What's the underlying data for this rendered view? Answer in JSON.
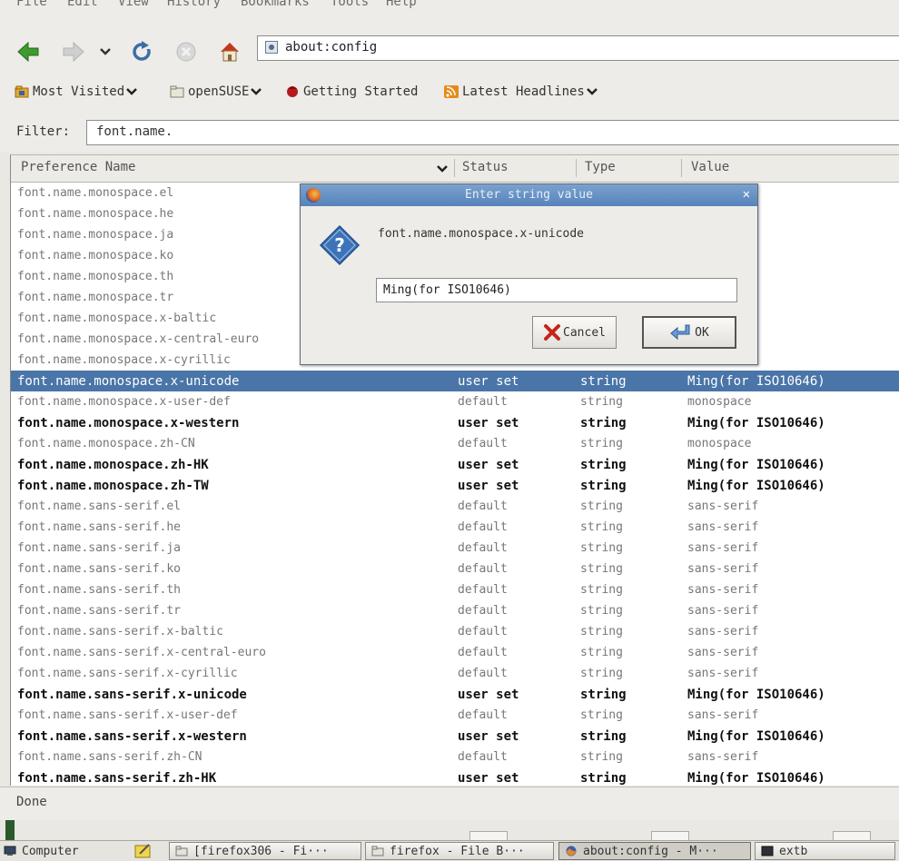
{
  "menubar": {
    "items": [
      "File",
      "Edit",
      "View",
      "History",
      "Bookmarks",
      "Tools",
      "Help"
    ]
  },
  "nav": {
    "url": "about:config"
  },
  "bookmarks": [
    {
      "label": "Most Visited",
      "icon": "most-visited-icon",
      "dropdown": true
    },
    {
      "label": "openSUSE",
      "icon": "folder-icon",
      "dropdown": true
    },
    {
      "label": "Getting Started",
      "icon": "getting-started-icon",
      "dropdown": false
    },
    {
      "label": "Latest Headlines",
      "icon": "rss-feed-icon",
      "dropdown": true
    }
  ],
  "filter": {
    "label": "Filter:",
    "value": "font.name."
  },
  "table": {
    "columns": [
      "Preference Name",
      "Status",
      "Type",
      "Value"
    ],
    "rows": [
      {
        "name": "font.name.monospace.el",
        "status": "",
        "type": "",
        "value": "",
        "state": "default"
      },
      {
        "name": "font.name.monospace.he",
        "status": "",
        "type": "",
        "value": "",
        "state": "default"
      },
      {
        "name": "font.name.monospace.ja",
        "status": "",
        "type": "",
        "value": "",
        "state": "default"
      },
      {
        "name": "font.name.monospace.ko",
        "status": "",
        "type": "",
        "value": "",
        "state": "default"
      },
      {
        "name": "font.name.monospace.th",
        "status": "",
        "type": "",
        "value": "",
        "state": "default"
      },
      {
        "name": "font.name.monospace.tr",
        "status": "",
        "type": "",
        "value": "",
        "state": "default"
      },
      {
        "name": "font.name.monospace.x-baltic",
        "status": "",
        "type": "",
        "value": "",
        "state": "default"
      },
      {
        "name": "font.name.monospace.x-central-euro",
        "status": "",
        "type": "",
        "value": "",
        "state": "default"
      },
      {
        "name": "font.name.monospace.x-cyrillic",
        "status": "",
        "type": "",
        "value": "",
        "state": "default"
      },
      {
        "name": "font.name.monospace.x-unicode",
        "status": "user set",
        "type": "string",
        "value": "Ming(for ISO10646)",
        "state": "selected"
      },
      {
        "name": "font.name.monospace.x-user-def",
        "status": "default",
        "type": "string",
        "value": "monospace",
        "state": "default"
      },
      {
        "name": "font.name.monospace.x-western",
        "status": "user set",
        "type": "string",
        "value": "Ming(for ISO10646)",
        "state": "userset"
      },
      {
        "name": "font.name.monospace.zh-CN",
        "status": "default",
        "type": "string",
        "value": "monospace",
        "state": "default"
      },
      {
        "name": "font.name.monospace.zh-HK",
        "status": "user set",
        "type": "string",
        "value": "Ming(for ISO10646)",
        "state": "userset"
      },
      {
        "name": "font.name.monospace.zh-TW",
        "status": "user set",
        "type": "string",
        "value": "Ming(for ISO10646)",
        "state": "userset"
      },
      {
        "name": "font.name.sans-serif.el",
        "status": "default",
        "type": "string",
        "value": "sans-serif",
        "state": "default"
      },
      {
        "name": "font.name.sans-serif.he",
        "status": "default",
        "type": "string",
        "value": "sans-serif",
        "state": "default"
      },
      {
        "name": "font.name.sans-serif.ja",
        "status": "default",
        "type": "string",
        "value": "sans-serif",
        "state": "default"
      },
      {
        "name": "font.name.sans-serif.ko",
        "status": "default",
        "type": "string",
        "value": "sans-serif",
        "state": "default"
      },
      {
        "name": "font.name.sans-serif.th",
        "status": "default",
        "type": "string",
        "value": "sans-serif",
        "state": "default"
      },
      {
        "name": "font.name.sans-serif.tr",
        "status": "default",
        "type": "string",
        "value": "sans-serif",
        "state": "default"
      },
      {
        "name": "font.name.sans-serif.x-baltic",
        "status": "default",
        "type": "string",
        "value": "sans-serif",
        "state": "default"
      },
      {
        "name": "font.name.sans-serif.x-central-euro",
        "status": "default",
        "type": "string",
        "value": "sans-serif",
        "state": "default"
      },
      {
        "name": "font.name.sans-serif.x-cyrillic",
        "status": "default",
        "type": "string",
        "value": "sans-serif",
        "state": "default"
      },
      {
        "name": "font.name.sans-serif.x-unicode",
        "status": "user set",
        "type": "string",
        "value": "Ming(for ISO10646)",
        "state": "userset"
      },
      {
        "name": "font.name.sans-serif.x-user-def",
        "status": "default",
        "type": "string",
        "value": "sans-serif",
        "state": "default"
      },
      {
        "name": "font.name.sans-serif.x-western",
        "status": "user set",
        "type": "string",
        "value": "Ming(for ISO10646)",
        "state": "userset"
      },
      {
        "name": "font.name.sans-serif.zh-CN",
        "status": "default",
        "type": "string",
        "value": "sans-serif",
        "state": "default"
      },
      {
        "name": "font.name.sans-serif.zh-HK",
        "status": "user set",
        "type": "string",
        "value": "Ming(for ISO10646)",
        "state": "userset"
      }
    ]
  },
  "dialog": {
    "title": "Enter string value",
    "prompt": "font.name.monospace.x-unicode",
    "value": "Ming(for ISO10646)",
    "cancel_label": "Cancel",
    "ok_label": "OK"
  },
  "statusbar": {
    "text": "Done"
  },
  "taskbar": {
    "items": [
      {
        "label": "Computer",
        "icon": "computer-icon"
      },
      {
        "label": "[firefox306 - Fi···",
        "icon": "folder-icon"
      },
      {
        "label": "firefox - File B···",
        "icon": "folder-icon"
      },
      {
        "label": "about:config - M···",
        "icon": "firefox-icon"
      },
      {
        "label": "extb",
        "icon": "terminal-icon"
      }
    ]
  }
}
